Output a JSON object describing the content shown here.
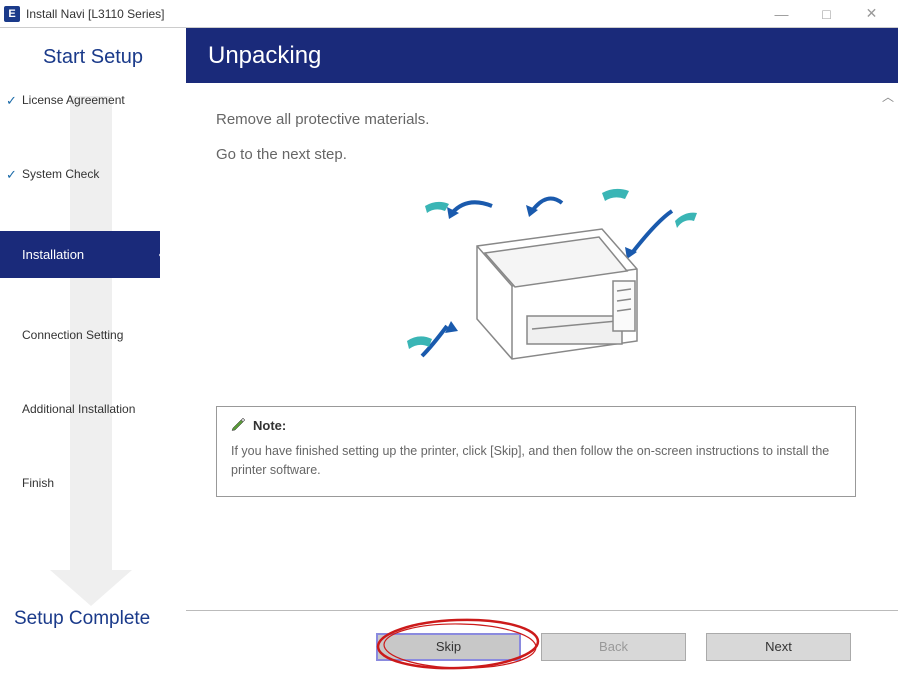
{
  "titlebar": {
    "icon_label": "E",
    "title": "Install Navi [L3110 Series]"
  },
  "window_controls": {
    "minimize": "—",
    "maximize": "□",
    "close": "✕"
  },
  "sidebar": {
    "start_label": "Start Setup",
    "complete_label": "Setup Complete",
    "steps": {
      "license": "License Agreement",
      "system": "System Check",
      "installation": "Installation",
      "connection": "Connection Setting",
      "additional": "Additional Installation",
      "finish": "Finish"
    }
  },
  "header": {
    "title": "Unpacking"
  },
  "content": {
    "line1": "Remove all protective materials.",
    "line2": "Go to the next step."
  },
  "note": {
    "label": "Note:",
    "text": "If you have finished setting up the printer, click [Skip], and then follow the on-screen instructions to install the printer software."
  },
  "buttons": {
    "skip": "Skip",
    "back": "Back",
    "next": "Next"
  }
}
